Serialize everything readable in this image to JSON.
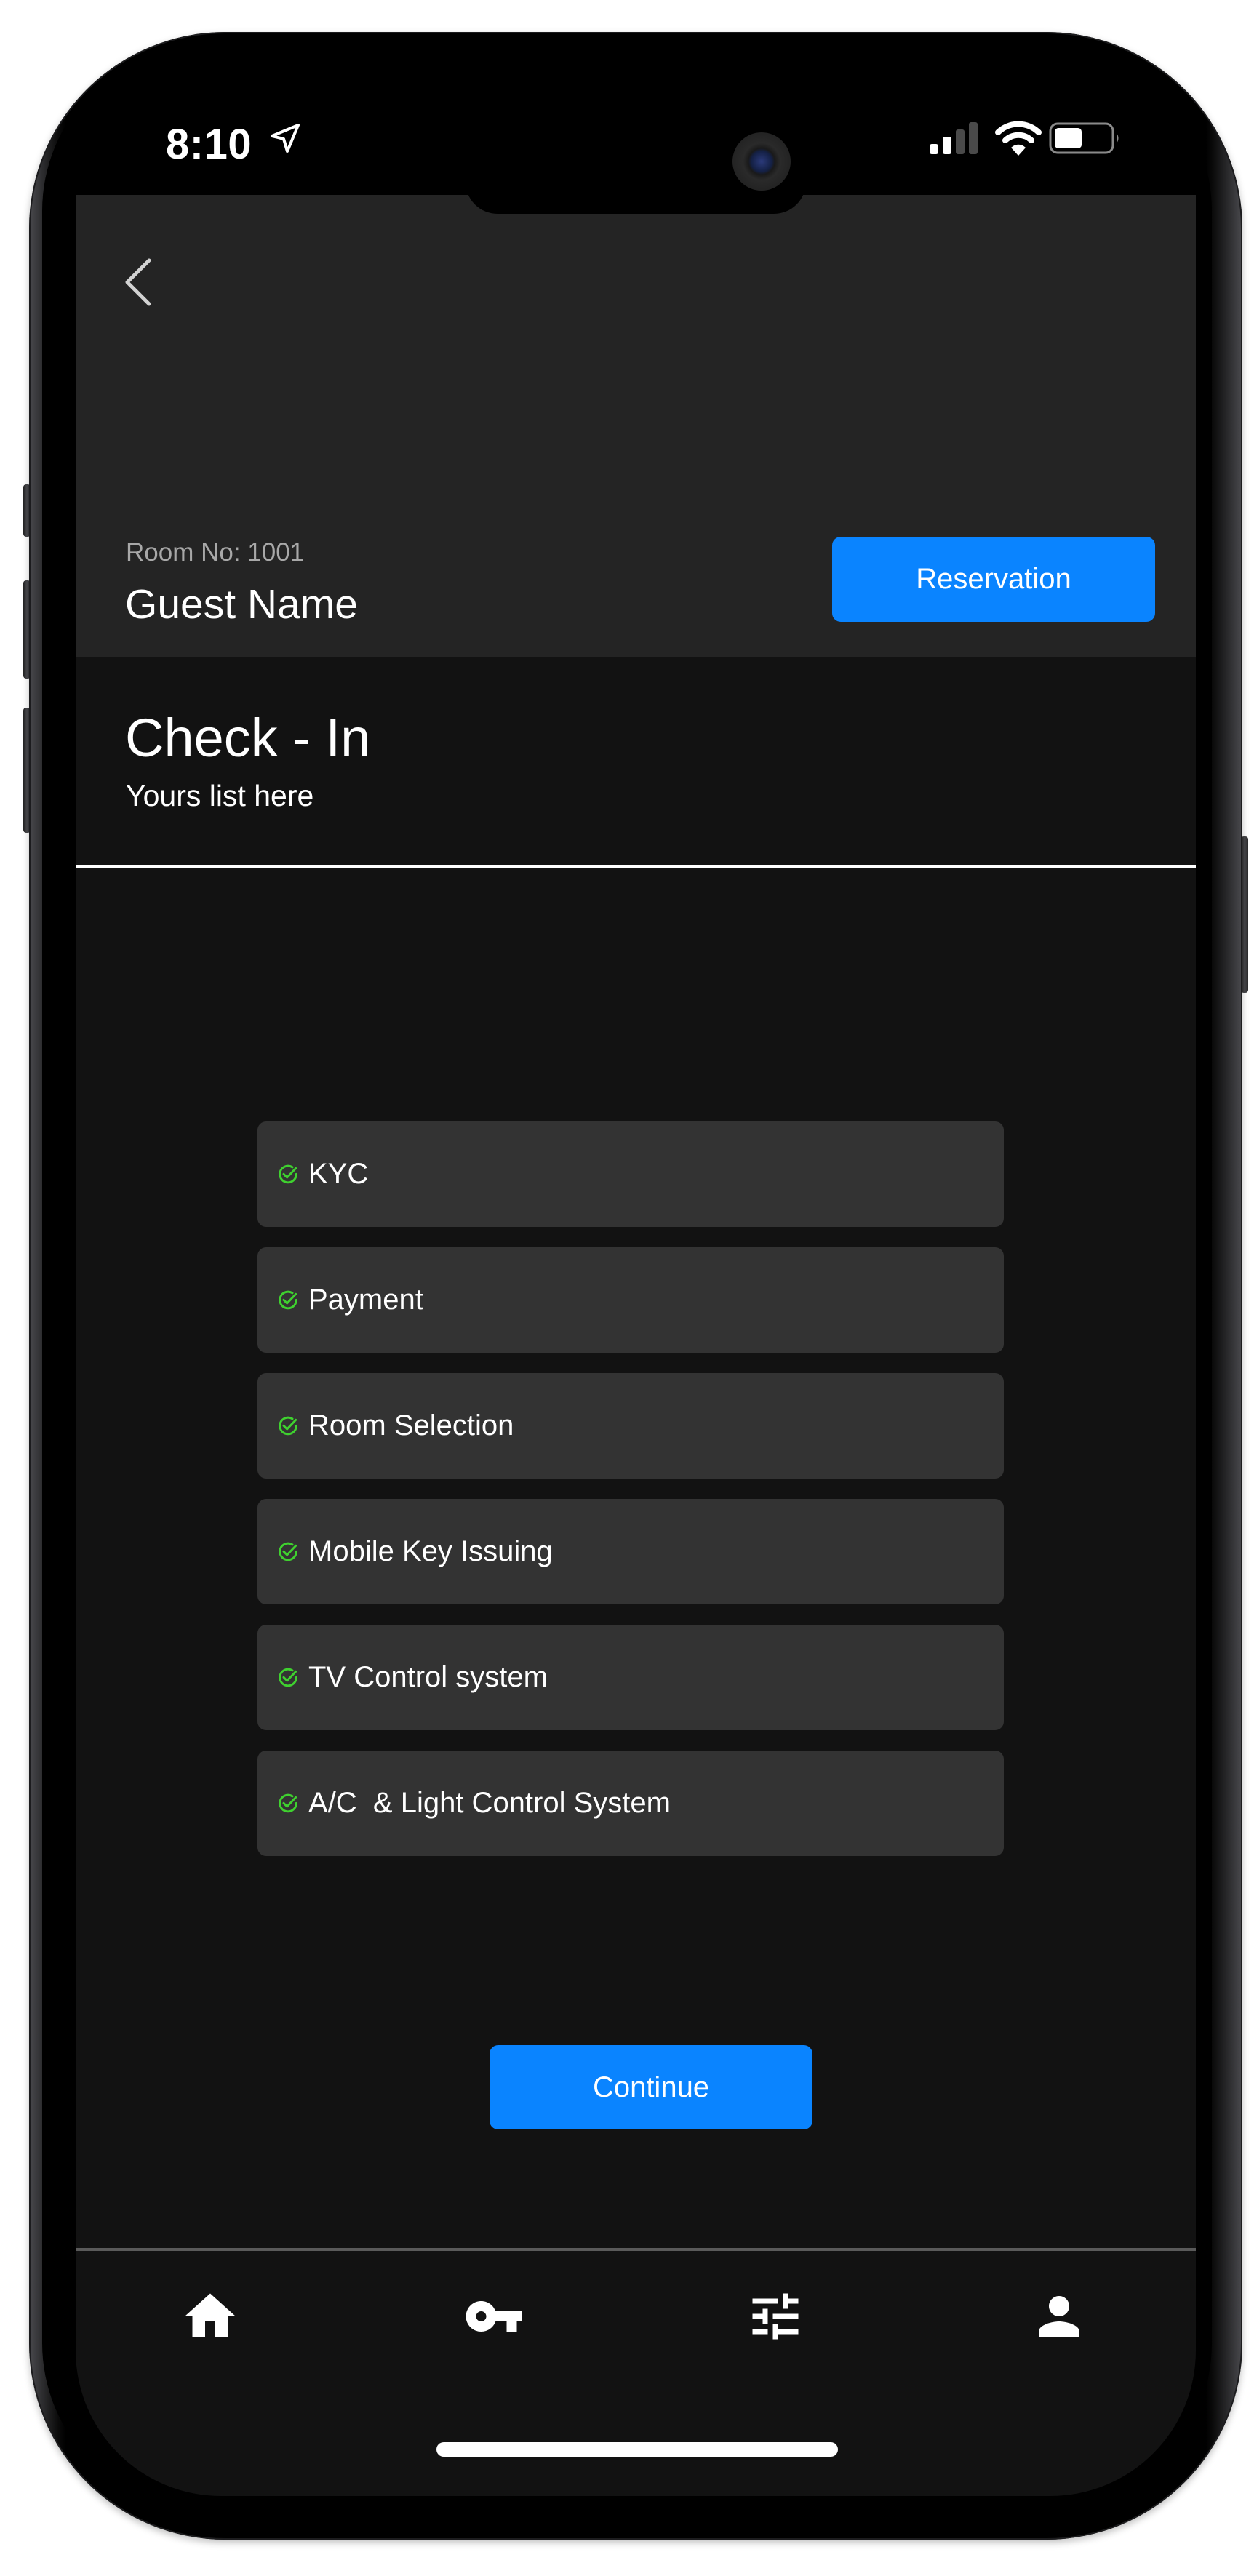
{
  "status_bar": {
    "time": "8:10",
    "location_icon": "location-arrow-icon",
    "signal_icon": "cellular-signal-icon",
    "signal_bars_active": 2,
    "signal_bars_total": 4,
    "wifi_icon": "wifi-icon",
    "battery_icon": "battery-icon",
    "battery_level": 0.5
  },
  "header": {
    "back_icon": "chevron-left-icon",
    "room_no": "Room No: 1001",
    "guest_name": "Guest Name",
    "reservation_label": "Reservation"
  },
  "section": {
    "title": "Check - In",
    "subtitle": "Yours list here"
  },
  "checklist": {
    "check_icon": "check-circle-icon",
    "items": [
      {
        "label": "KYC",
        "done": true
      },
      {
        "label": "Payment",
        "done": true
      },
      {
        "label": "Room Selection",
        "done": true
      },
      {
        "label": "Mobile Key Issuing",
        "done": true
      },
      {
        "label": "TV Control system",
        "done": true
      },
      {
        "label": "A/C  & Light Control System",
        "done": true
      }
    ]
  },
  "continue_label": "Continue",
  "bottom_nav": {
    "items": [
      {
        "name": "home",
        "icon": "home-icon"
      },
      {
        "name": "key",
        "icon": "key-icon"
      },
      {
        "name": "controls",
        "icon": "sliders-icon"
      },
      {
        "name": "profile",
        "icon": "person-icon"
      }
    ]
  },
  "colors": {
    "accent": "#0a84ff",
    "check_green": "#3fd12f",
    "screen_bg": "#121212",
    "header_bg": "#242424",
    "card_bg": "#333333"
  }
}
